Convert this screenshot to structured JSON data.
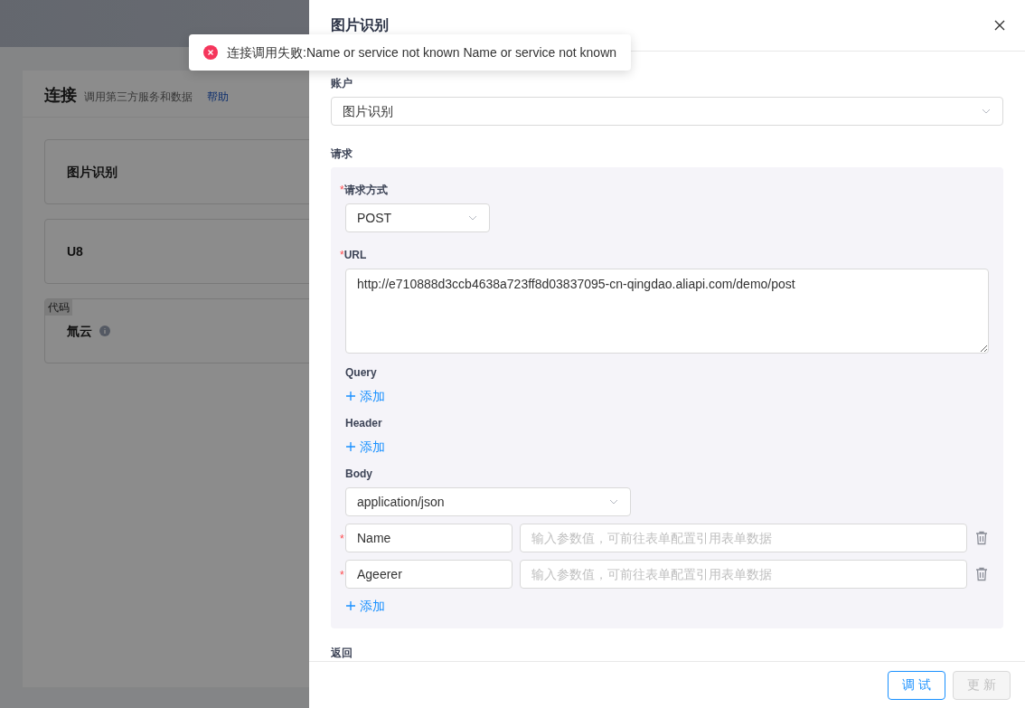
{
  "background": {
    "header": {
      "title": "连接",
      "subtitle": "调用第三方服务和数据",
      "help_link": "帮助"
    },
    "connections": [
      {
        "name": "图片识别",
        "info": false
      },
      {
        "name": "U8",
        "info": false
      },
      {
        "name": "氚云",
        "tag": "代码",
        "info": true
      }
    ]
  },
  "drawer": {
    "title": "图片识别",
    "account": {
      "label": "账户",
      "value": "图片识别"
    },
    "request": {
      "title": "请求",
      "method": {
        "label": "请求方式",
        "required_mark": "*",
        "value": "POST"
      },
      "url": {
        "label": "URL",
        "required_mark": "*",
        "value": "http://e710888d3ccb4638a723ff8d03837095-cn-qingdao.aliapi.com/demo/post"
      },
      "query": {
        "label": "Query",
        "add": "添加"
      },
      "header": {
        "label": "Header",
        "add": "添加"
      },
      "body": {
        "label": "Body",
        "type": "application/json",
        "add": "添加",
        "params": [
          {
            "name": "Name",
            "required_mark": "*",
            "placeholder": "输入参数值，可前往表单配置引用表单数据"
          },
          {
            "name": "Ageerer",
            "required_mark": "*",
            "placeholder": "输入参数值，可前往表单配置引用表单数据"
          }
        ]
      }
    },
    "response": {
      "title": "返回"
    },
    "buttons": [
      {
        "label": "调 试",
        "kind": "primary",
        "disabled": false
      },
      {
        "label": "更 新",
        "kind": "default",
        "disabled": true
      }
    ]
  },
  "toast": {
    "kind": "error",
    "message": "连接调用失败:Name or service not known Name or service not known"
  }
}
